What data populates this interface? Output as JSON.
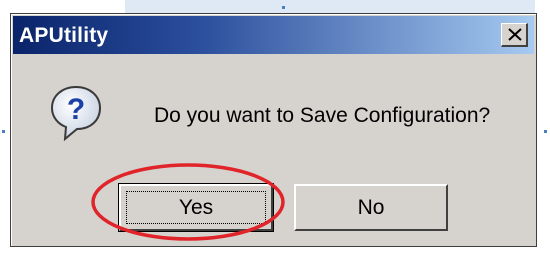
{
  "window": {
    "title": "APUtility"
  },
  "dialog": {
    "message": "Do you want to Save Configuration?",
    "icon": "question-icon"
  },
  "buttons": {
    "yes_label": "Yes",
    "no_label": "No",
    "close_icon": "close-icon"
  },
  "annotation": {
    "highlight_color": "#e0242a"
  }
}
